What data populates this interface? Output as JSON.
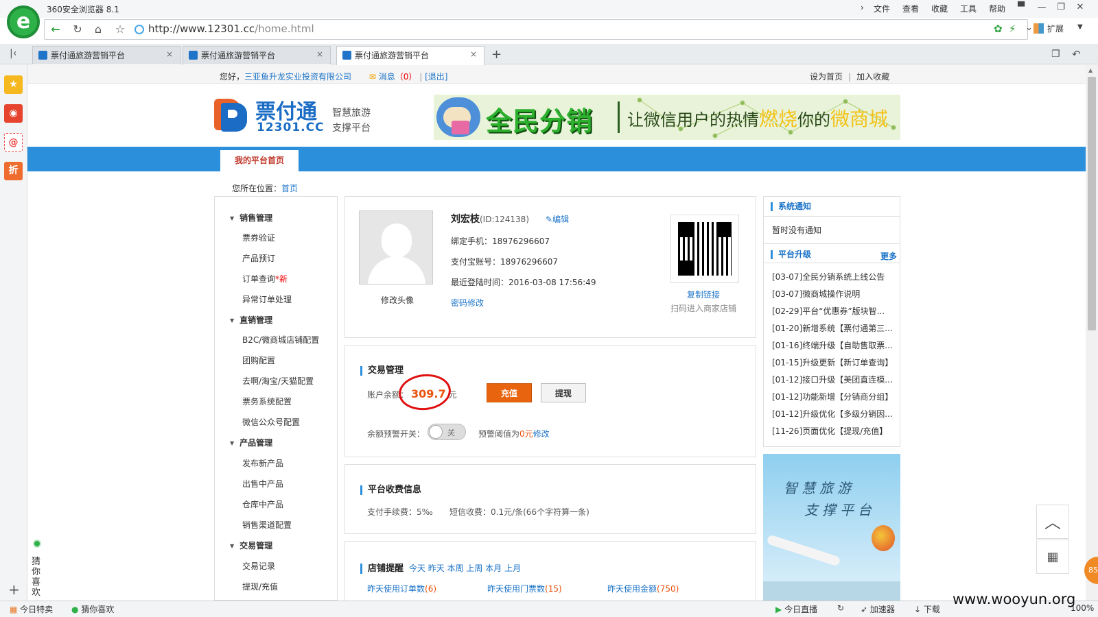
{
  "browser": {
    "title": "360安全浏览器 8.1",
    "logo_glyph": "e",
    "menu": [
      "文件",
      "查看",
      "收藏",
      "工具",
      "帮助"
    ],
    "url_host": "http://www.12301.cc",
    "url_path": "/home.html",
    "extensions_label": "扩展",
    "tabs": [
      {
        "label": "票付通旅游营销平台"
      },
      {
        "label": "票付通旅游营销平台"
      },
      {
        "label": "票付通旅游营销平台"
      }
    ],
    "rail_zhe": "折",
    "left_guess": "猜你喜欢",
    "status": {
      "today_special": "今日特卖",
      "guess_like": "猜你喜欢",
      "live": "今日直播",
      "accelerator": "加速器",
      "download": "下载",
      "zoom": "100%"
    }
  },
  "header": {
    "greeting": "您好，",
    "company": "三亚鱼升龙实业投资有限公司",
    "messages_label": "消息",
    "messages_count": "（0）",
    "logout": "[退出]",
    "set_home": "设为首页",
    "add_fav": "加入收藏"
  },
  "brand": {
    "name": "票付通",
    "domain": "12301.CC",
    "tagline1": "智慧旅游",
    "tagline2": "支撑平台"
  },
  "ad_banner": {
    "headline": "全民分销",
    "slogan_a": "让微信用户的热情",
    "slogan_hot": "燃烧",
    "slogan_b": "你的",
    "slogan_c": "微商城"
  },
  "nav": {
    "home_tab": "我的平台首页"
  },
  "breadcrumb": {
    "label": "您所在位置：",
    "home": "首页"
  },
  "sidebar": {
    "groups": [
      {
        "title": "销售管理",
        "items": [
          "票券验证",
          "产品预订",
          "订单查询",
          "异常订单处理"
        ],
        "new_tag": "*新"
      },
      {
        "title": "直销管理",
        "items": [
          "B2C/微商城店铺配置",
          "团购配置",
          "去啊/淘宝/天猫配置",
          "票务系统配置",
          "微信公众号配置"
        ]
      },
      {
        "title": "产品管理",
        "items": [
          "发布新产品",
          "出售中产品",
          "仓库中产品",
          "销售渠道配置"
        ]
      },
      {
        "title": "交易管理",
        "items": [
          "交易记录",
          "提现/充值"
        ]
      }
    ]
  },
  "profile": {
    "name": "刘宏枝",
    "id": "(ID:124138)",
    "edit": "编辑",
    "phone": "绑定手机：18976296607",
    "alipay": "支付宝账号：18976296607",
    "last_login": "最近登陆时间：2016-03-08 17:56:49",
    "change_pwd": "密码修改",
    "change_avatar": "修改头像",
    "copy_link": "复制链接",
    "scan_hint": "扫码进入商家店铺"
  },
  "trade": {
    "title": "交易管理",
    "balance_label": "账户余额：",
    "balance": "309.7",
    "balance_unit": "元",
    "recharge": "充值",
    "withdraw": "提现",
    "warn_label": "余额预警开关：",
    "toggle": "关",
    "threshold_a": "预警阈值为",
    "threshold_val": "0元",
    "threshold_edit": "修改"
  },
  "fees": {
    "title": "平台收费信息",
    "pay_fee": "支付手续费：5‰",
    "sms_fee": "短信收费：0.1元/条(66个字符算一条)"
  },
  "shop": {
    "title": "店铺提醒",
    "periods": [
      "今天",
      "昨天",
      "本周",
      "上周",
      "本月",
      "上月"
    ],
    "stats": [
      {
        "label": "昨天使用订单数",
        "value": "(6)"
      },
      {
        "label": "昨天使用门票数",
        "value": "(15)"
      },
      {
        "label": "昨天使用金额",
        "value": "(750)"
      }
    ]
  },
  "notices": {
    "system_title": "系统通知",
    "system_empty": "暂时没有通知",
    "upgrade_title": "平台升级",
    "more": "更多",
    "items": [
      "[03-07]全民分销系统上线公告",
      "[03-07]微商城操作说明",
      "[02-29]平台“优惠券”版块智...",
      "[01-20]新增系统【票付通第三...",
      "[01-16]终端升级【自助售取票...",
      "[01-15]升级更新【新订单查询】",
      "[01-12]接口升级【美团直连模...",
      "[01-12]功能新增【分销商分组】",
      "[01-12]升级优化【多级分销因...",
      "[11-26]页面优化【提现/充值】"
    ]
  },
  "promo": {
    "line1": "智慧旅游",
    "line2": "支撑平台"
  },
  "float_badge": "85",
  "watermark": "www.wooyun.org"
}
